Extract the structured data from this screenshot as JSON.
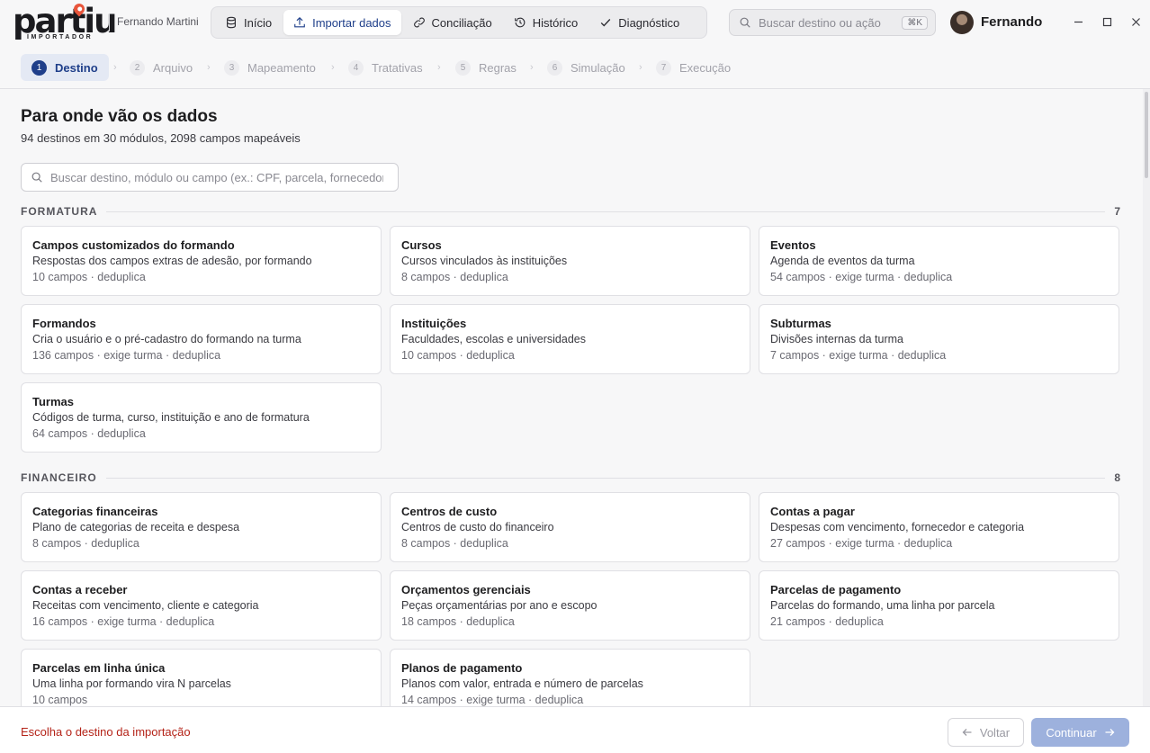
{
  "app": {
    "logo_text": "partiu",
    "logo_sub": "IMPORTADOR",
    "user_small": "Fernando Martini",
    "user_name": "Fernando"
  },
  "nav": [
    {
      "label": "Início",
      "icon": "database-icon",
      "active": false
    },
    {
      "label": "Importar dados",
      "icon": "upload-icon",
      "active": true
    },
    {
      "label": "Conciliação",
      "icon": "link-icon",
      "active": false
    },
    {
      "label": "Histórico",
      "icon": "history-icon",
      "active": false
    },
    {
      "label": "Diagnóstico",
      "icon": "check-icon",
      "active": false
    }
  ],
  "command_search": {
    "placeholder": "Buscar destino ou ação",
    "shortcut": "⌘K"
  },
  "window_controls": {
    "minimize": "–",
    "maximize": "□",
    "close": "✕"
  },
  "steps": [
    {
      "num": "1",
      "label": "Destino",
      "active": true
    },
    {
      "num": "2",
      "label": "Arquivo",
      "active": false
    },
    {
      "num": "3",
      "label": "Mapeamento",
      "active": false
    },
    {
      "num": "4",
      "label": "Tratativas",
      "active": false
    },
    {
      "num": "5",
      "label": "Regras",
      "active": false
    },
    {
      "num": "6",
      "label": "Simulação",
      "active": false
    },
    {
      "num": "7",
      "label": "Execução",
      "active": false
    }
  ],
  "main": {
    "title": "Para onde vão os dados",
    "subtitle": "94 destinos em 30 módulos, 2098 campos mapeáveis",
    "search_placeholder": "Buscar destino, módulo ou campo (ex.: CPF, parcela, fornecedor)"
  },
  "sections": [
    {
      "label": "FORMATURA",
      "count": "7",
      "cards": [
        {
          "title": "Campos customizados do formando",
          "desc": "Respostas dos campos extras de adesão, por formando",
          "meta": "10 campos · deduplica"
        },
        {
          "title": "Cursos",
          "desc": "Cursos vinculados às instituições",
          "meta": "8 campos · deduplica"
        },
        {
          "title": "Eventos",
          "desc": "Agenda de eventos da turma",
          "meta": "54 campos · exige turma · deduplica"
        },
        {
          "title": "Formandos",
          "desc": "Cria o usuário e o pré-cadastro do formando na turma",
          "meta": "136 campos · exige turma · deduplica"
        },
        {
          "title": "Instituições",
          "desc": "Faculdades, escolas e universidades",
          "meta": "10 campos · deduplica"
        },
        {
          "title": "Subturmas",
          "desc": "Divisões internas da turma",
          "meta": "7 campos · exige turma · deduplica"
        },
        {
          "title": "Turmas",
          "desc": "Códigos de turma, curso, instituição e ano de formatura",
          "meta": "64 campos · deduplica"
        }
      ]
    },
    {
      "label": "FINANCEIRO",
      "count": "8",
      "cards": [
        {
          "title": "Categorias financeiras",
          "desc": "Plano de categorias de receita e despesa",
          "meta": "8 campos · deduplica"
        },
        {
          "title": "Centros de custo",
          "desc": "Centros de custo do financeiro",
          "meta": "8 campos · deduplica"
        },
        {
          "title": "Contas a pagar",
          "desc": "Despesas com vencimento, fornecedor e categoria",
          "meta": "27 campos · exige turma · deduplica"
        },
        {
          "title": "Contas a receber",
          "desc": "Receitas com vencimento, cliente e categoria",
          "meta": "16 campos · exige turma · deduplica"
        },
        {
          "title": "Orçamentos gerenciais",
          "desc": "Peças orçamentárias por ano e escopo",
          "meta": "18 campos · deduplica"
        },
        {
          "title": "Parcelas de pagamento",
          "desc": "Parcelas do formando, uma linha por parcela",
          "meta": "21 campos · deduplica"
        },
        {
          "title": "Parcelas em linha única",
          "desc": "Uma linha por formando vira N parcelas",
          "meta": "10 campos"
        },
        {
          "title": "Planos de pagamento",
          "desc": "Planos com valor, entrada e número de parcelas",
          "meta": "14 campos · exige turma · deduplica"
        }
      ]
    }
  ],
  "footer": {
    "hint": "Escolha o destino da importação",
    "back_label": "Voltar",
    "next_label": "Continuar"
  }
}
